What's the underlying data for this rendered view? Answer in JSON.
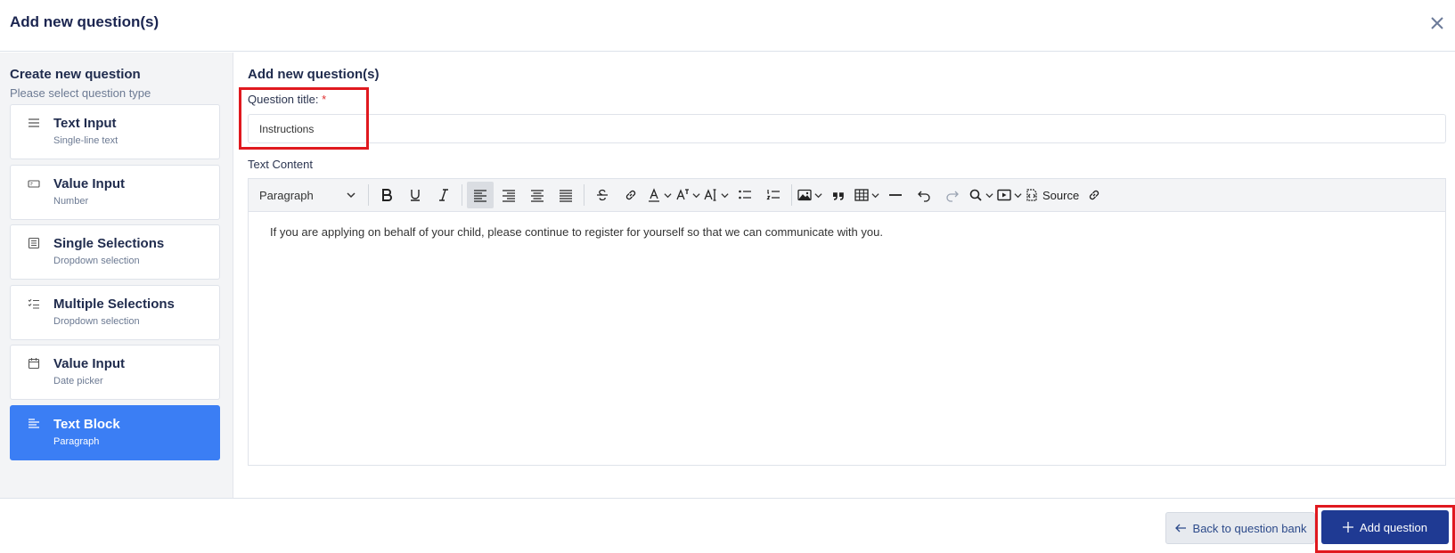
{
  "header": {
    "title": "Add new question(s)",
    "close_icon": "close-icon"
  },
  "sidebar": {
    "title": "Create new question",
    "subtitle": "Please select question type",
    "items": [
      {
        "label": "Text Input",
        "desc": "Single-line text",
        "icon": "lines-icon",
        "active": false
      },
      {
        "label": "Value Input",
        "desc": "Number",
        "icon": "number-field-icon",
        "active": false
      },
      {
        "label": "Single Selections",
        "desc": "Dropdown selection",
        "icon": "list-icon",
        "active": false
      },
      {
        "label": "Multiple Selections",
        "desc": "Dropdown selection",
        "icon": "checklist-icon",
        "active": false
      },
      {
        "label": "Value Input",
        "desc": "Date picker",
        "icon": "calendar-icon",
        "active": false
      },
      {
        "label": "Text Block",
        "desc": "Paragraph",
        "icon": "paragraph-icon",
        "active": true
      }
    ]
  },
  "main": {
    "title": "Add new question(s)",
    "question_title_label": "Question title:",
    "required_mark": "*",
    "question_title_value": "Instructions",
    "text_content_label": "Text Content",
    "toolbar": {
      "paragraph": "Paragraph",
      "source": "Source"
    },
    "editor_text": "If you are applying on behalf of your child, please continue to register for yourself so that we can communicate with you."
  },
  "footer": {
    "back_label": "Back to question bank",
    "add_label": "Add question"
  },
  "colors": {
    "accent": "#3b7ef4",
    "primary_button": "#1f3a93",
    "highlight": "#e0191f"
  }
}
